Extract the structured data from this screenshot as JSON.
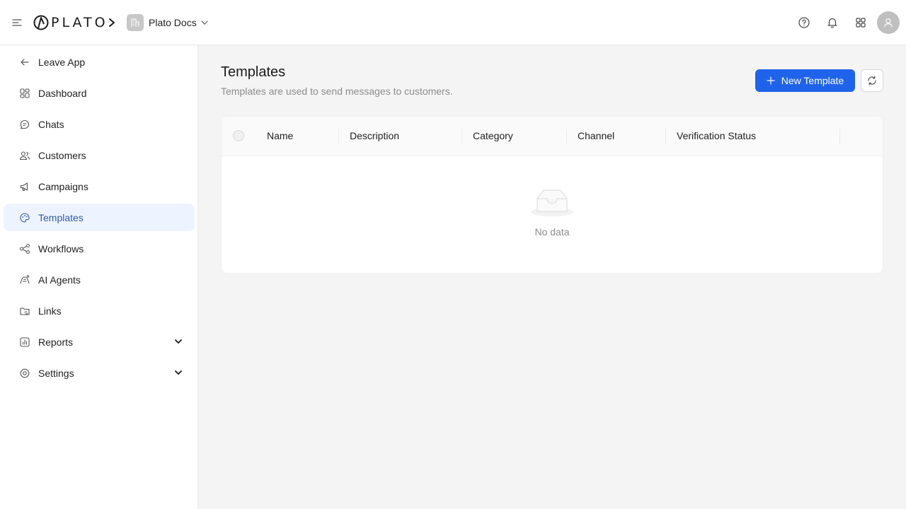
{
  "header": {
    "logo_text": "PLATO",
    "workspace": "Plato Docs"
  },
  "sidebar": {
    "items": [
      {
        "label": "Leave App"
      },
      {
        "label": "Dashboard"
      },
      {
        "label": "Chats"
      },
      {
        "label": "Customers"
      },
      {
        "label": "Campaigns"
      },
      {
        "label": "Templates"
      },
      {
        "label": "Workflows"
      },
      {
        "label": "AI Agents"
      },
      {
        "label": "Links"
      },
      {
        "label": "Reports"
      },
      {
        "label": "Settings"
      }
    ]
  },
  "main": {
    "title": "Templates",
    "subtitle": "Templates are used to send messages to customers.",
    "new_button": "New Template",
    "table": {
      "columns": [
        "Name",
        "Description",
        "Category",
        "Channel",
        "Verification Status"
      ],
      "empty_text": "No data"
    }
  },
  "colors": {
    "accent": "#1f63ea",
    "active_bg": "#eef4ff",
    "active_text": "#2f5aa8"
  }
}
